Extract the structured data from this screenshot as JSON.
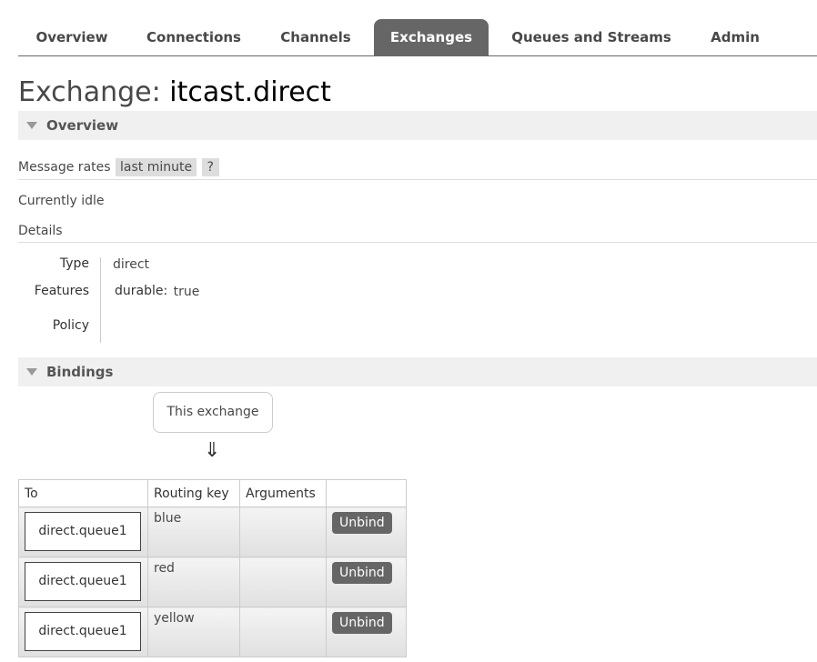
{
  "nav": {
    "tabs": [
      {
        "label": "Overview",
        "active": false
      },
      {
        "label": "Connections",
        "active": false
      },
      {
        "label": "Channels",
        "active": false
      },
      {
        "label": "Exchanges",
        "active": true
      },
      {
        "label": "Queues and Streams",
        "active": false
      },
      {
        "label": "Admin",
        "active": false
      }
    ]
  },
  "page": {
    "title_prefix": "Exchange:",
    "exchange_name": "itcast.direct"
  },
  "overview": {
    "header": "Overview",
    "message_rates_label": "Message rates",
    "message_rates_range": "last minute",
    "help": "?",
    "status": "Currently idle",
    "details_label": "Details",
    "type_label": "Type",
    "type_value": "direct",
    "features_label": "Features",
    "feature_key": "durable:",
    "feature_value": "true",
    "policy_label": "Policy"
  },
  "bindings": {
    "header": "Bindings",
    "this_exchange": "This exchange",
    "arrow": "⇓",
    "columns": [
      "To",
      "Routing key",
      "Arguments",
      ""
    ],
    "rows": [
      {
        "to": "direct.queue1",
        "routing_key": "blue",
        "arguments": "",
        "action": "Unbind"
      },
      {
        "to": "direct.queue1",
        "routing_key": "red",
        "arguments": "",
        "action": "Unbind"
      },
      {
        "to": "direct.queue1",
        "routing_key": "yellow",
        "arguments": "",
        "action": "Unbind"
      }
    ]
  }
}
